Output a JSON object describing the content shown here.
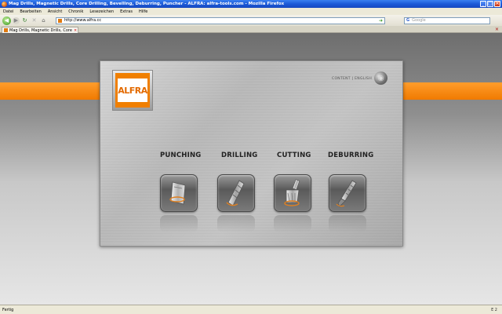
{
  "window": {
    "title": "Mag Drills, Magnetic Drills, Core Drilling, Bevelling, Deburring, Puncher - ALFRA: alfra-tools.com - Mozilla Firefox",
    "min_label": "_",
    "max_label": "□",
    "close_label": "×"
  },
  "menu": {
    "items": [
      "Datei",
      "Bearbeiten",
      "Ansicht",
      "Chronik",
      "Lesezeichen",
      "Extras",
      "Hilfe"
    ]
  },
  "nav": {
    "back_glyph": "◀",
    "forward_glyph": "▶",
    "reload_glyph": "↻",
    "stop_glyph": "✕",
    "home_glyph": "⌂",
    "url": "http://www.alfra.cc",
    "go_glyph": "➜",
    "search_engine_label": "G",
    "search_placeholder": "Google"
  },
  "tabs": [
    {
      "label": "Mag Drills, Magnetic Drills, Core Drilli...",
      "close_glyph": "×"
    }
  ],
  "tabbar_close_glyph": "×",
  "page": {
    "logo_text": "ALFRA",
    "lang_link": "CONTENT | ENGLISH",
    "globe_glyph": "◉",
    "categories": [
      {
        "label": "PUNCHING"
      },
      {
        "label": "DRILLING"
      },
      {
        "label": "CUTTING"
      },
      {
        "label": "DEBURRING"
      }
    ],
    "colors": {
      "accent": "#f07a00",
      "panel": "#c0c0c0"
    }
  },
  "status": {
    "text": "Fertig",
    "right_text": "E 2"
  }
}
